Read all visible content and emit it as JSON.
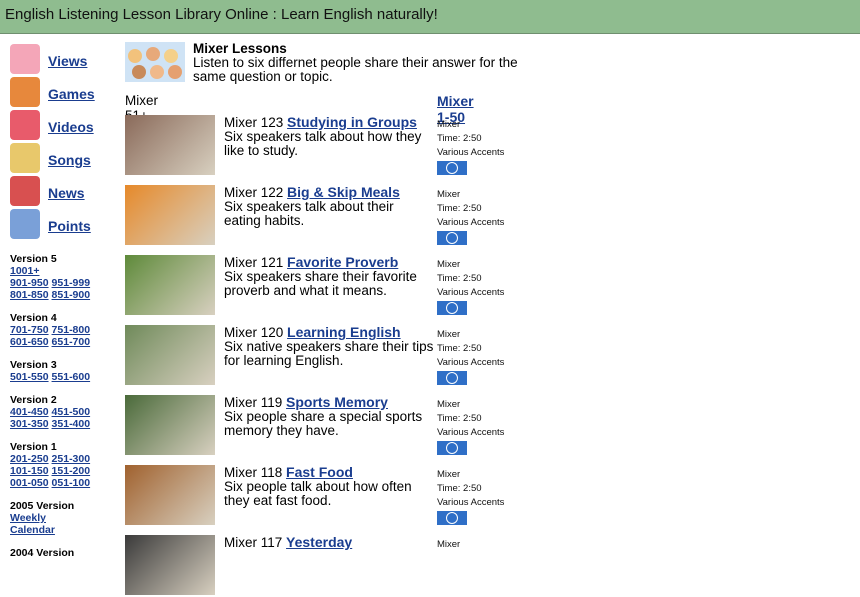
{
  "header": {
    "title": "English Listening Lesson Library Online : Learn English naturally!"
  },
  "nav": [
    {
      "label": "Views",
      "icon": "person-views-icon",
      "color": "#f4a6b8"
    },
    {
      "label": "Games",
      "icon": "puzzle-games-icon",
      "color": "#e7883c"
    },
    {
      "label": "Videos",
      "icon": "person-video-icon",
      "color": "#e85b6b"
    },
    {
      "label": "Songs",
      "icon": "person-singing-icon",
      "color": "#e8c86b"
    },
    {
      "label": "News",
      "icon": "person-news-icon",
      "color": "#d85050"
    },
    {
      "label": "Points",
      "icon": "person-points-icon",
      "color": "#7aa0d8"
    }
  ],
  "versions": [
    {
      "title": "Version 5",
      "rows": [
        [
          "1001+"
        ],
        [
          "901-950",
          "951-999"
        ],
        [
          "801-850",
          "851-900"
        ]
      ]
    },
    {
      "title": "Version 4",
      "rows": [
        [
          "701-750",
          "751-800"
        ],
        [
          "601-650",
          "651-700"
        ]
      ]
    },
    {
      "title": "Version 3",
      "rows": [
        [
          "501-550",
          "551-600"
        ]
      ]
    },
    {
      "title": "Version 2",
      "rows": [
        [
          "401-450",
          "451-500"
        ],
        [
          "301-350",
          "351-400"
        ]
      ]
    },
    {
      "title": "Version 1",
      "rows": [
        [
          "201-250",
          "251-300"
        ],
        [
          "101-150",
          "151-200"
        ],
        [
          "001-050",
          "051-100"
        ]
      ]
    },
    {
      "title": "2005 Version",
      "rows": [
        [
          "Weekly"
        ],
        [
          "Calendar"
        ]
      ]
    },
    {
      "title": "2004 Version",
      "rows": []
    }
  ],
  "section": {
    "title": "Mixer Lessons",
    "description": "Listen to six differnet people share their answer for the same question or topic.",
    "current_label": "Mixer 51+",
    "other_link": "Mixer 1-50"
  },
  "lessons": [
    {
      "prefix": "Mixer 123",
      "title": "Studying in Groups",
      "desc": "Six speakers talk about how they like to study.",
      "type": "Mixer",
      "time": "Time: 2:50",
      "accents": "Various Accents",
      "img_color": "#8a6a5a"
    },
    {
      "prefix": "Mixer 122",
      "title": "Big & Skip Meals",
      "desc": "Six speakers talk about their eating habits.",
      "type": "Mixer",
      "time": "Time: 2:50",
      "accents": "Various Accents",
      "img_color": "#e6892a"
    },
    {
      "prefix": "Mixer 121",
      "title": "Favorite Proverb",
      "desc": "Six speakers share their favorite proverb and what it means.",
      "type": "Mixer",
      "time": "Time: 2:50",
      "accents": "Various Accents",
      "img_color": "#5e8a3a"
    },
    {
      "prefix": "Mixer 120",
      "title": "Learning English",
      "desc": "Six native speakers share their tips for learning English.",
      "type": "Mixer",
      "time": "Time: 2:50",
      "accents": "Various Accents",
      "img_color": "#6f8a5a"
    },
    {
      "prefix": "Mixer 119",
      "title": "Sports Memory",
      "desc": "Six people share a special sports memory they have.",
      "type": "Mixer",
      "time": "Time: 2:50",
      "accents": "Various Accents",
      "img_color": "#4a6a3a"
    },
    {
      "prefix": "Mixer 118",
      "title": "Fast Food",
      "desc": "Six people talk about how often they eat fast food.",
      "type": "Mixer",
      "time": "Time: 2:50",
      "accents": "Various Accents",
      "img_color": "#a0612e"
    },
    {
      "prefix": "Mixer 117",
      "title": "Yesterday",
      "desc": "",
      "type": "Mixer",
      "time": "",
      "accents": "",
      "img_color": "#3a3a3a"
    }
  ]
}
